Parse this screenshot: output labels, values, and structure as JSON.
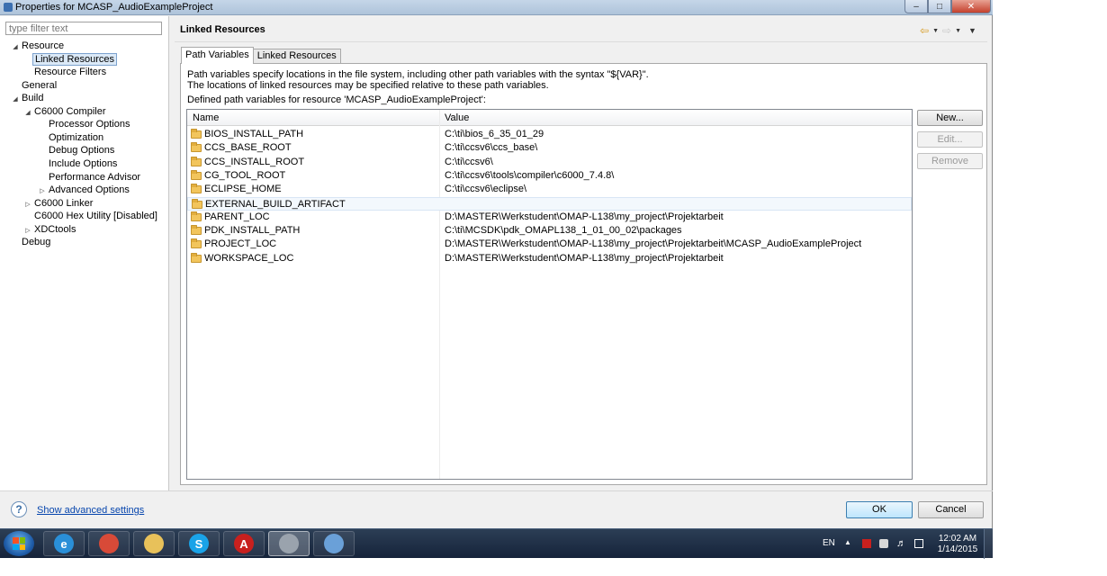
{
  "window": {
    "title": "Properties for MCASP_AudioExampleProject"
  },
  "filter": {
    "placeholder": "type filter text"
  },
  "tree": [
    {
      "label": "Resource",
      "expander": "open"
    },
    {
      "label": "Linked Resources",
      "expander": "none",
      "selected": true
    },
    {
      "label": "Resource Filters",
      "expander": "none"
    },
    {
      "label": "General",
      "expander": "none"
    },
    {
      "label": "Build",
      "expander": "open"
    },
    {
      "label": "C6000 Compiler",
      "expander": "open"
    },
    {
      "label": "Processor Options",
      "expander": "none"
    },
    {
      "label": "Optimization",
      "expander": "none"
    },
    {
      "label": "Debug Options",
      "expander": "none"
    },
    {
      "label": "Include Options",
      "expander": "none"
    },
    {
      "label": "Performance Advisor",
      "expander": "none"
    },
    {
      "label": "Advanced Options",
      "expander": "closed"
    },
    {
      "label": "C6000 Linker",
      "expander": "closed"
    },
    {
      "label": "C6000 Hex Utility  [Disabled]",
      "expander": "none"
    },
    {
      "label": "XDCtools",
      "expander": "closed"
    },
    {
      "label": "Debug",
      "expander": "none"
    }
  ],
  "page": {
    "title": "Linked Resources",
    "tabs": [
      {
        "label": "Path Variables",
        "active": true
      },
      {
        "label": "Linked Resources",
        "active": false
      }
    ],
    "description": [
      "Path variables specify locations in the file system, including other path variables with the syntax \"${VAR}\".",
      "The locations of linked resources may be specified relative to these path variables.",
      "Defined path variables for resource 'MCASP_AudioExampleProject':"
    ],
    "table": {
      "columns": [
        "Name",
        "Value"
      ],
      "rows": [
        {
          "name": "BIOS_INSTALL_PATH",
          "value": "C:\\ti\\bios_6_35_01_29"
        },
        {
          "name": "CCS_BASE_ROOT",
          "value": "C:\\ti\\ccsv6\\ccs_base\\"
        },
        {
          "name": "CCS_INSTALL_ROOT",
          "value": "C:\\ti\\ccsv6\\"
        },
        {
          "name": "CG_TOOL_ROOT",
          "value": "C:\\ti\\ccsv6\\tools\\compiler\\c6000_7.4.8\\"
        },
        {
          "name": "ECLIPSE_HOME",
          "value": "C:\\ti\\ccsv6\\eclipse\\"
        },
        {
          "name": "EXTERNAL_BUILD_ARTIFACT",
          "value": ""
        },
        {
          "name": "PARENT_LOC",
          "value": "D:\\MASTER\\Werkstudent\\OMAP-L138\\my_project\\Projektarbeit"
        },
        {
          "name": "PDK_INSTALL_PATH",
          "value": "C:\\ti\\MCSDK\\pdk_OMAPL138_1_01_00_02\\packages"
        },
        {
          "name": "PROJECT_LOC",
          "value": "D:\\MASTER\\Werkstudent\\OMAP-L138\\my_project\\Projektarbeit\\MCASP_AudioExampleProject"
        },
        {
          "name": "WORKSPACE_LOC",
          "value": "D:\\MASTER\\Werkstudent\\OMAP-L138\\my_project\\Projektarbeit"
        }
      ]
    },
    "buttons": {
      "new": "New...",
      "edit": "Edit...",
      "remove": "Remove"
    }
  },
  "footer": {
    "advanced_link": "Show advanced settings",
    "ok": "OK",
    "cancel": "Cancel"
  },
  "taskbar": {
    "apps": [
      {
        "icon": "internet-explorer-icon",
        "glyph": "e",
        "color": "#2a8fd8"
      },
      {
        "icon": "chrome-icon",
        "glyph": "",
        "color": "#d84a38"
      },
      {
        "icon": "file-explorer-icon",
        "glyph": "",
        "color": "#e8c15a"
      },
      {
        "icon": "skype-icon",
        "glyph": "S",
        "color": "#1aa3e8"
      },
      {
        "icon": "acrobat-icon",
        "glyph": "A",
        "color": "#c8201e"
      },
      {
        "icon": "virtualbox-icon",
        "glyph": "",
        "color": "#9aa3ad"
      },
      {
        "icon": "paint-icon",
        "glyph": "",
        "color": "#6aa0d8"
      }
    ],
    "language": "EN",
    "time": "12:02 AM",
    "date": "1/14/2015"
  },
  "colors": {
    "selection": "#dbe9f7",
    "link": "#0645ad",
    "folder": "#f2c55c"
  }
}
